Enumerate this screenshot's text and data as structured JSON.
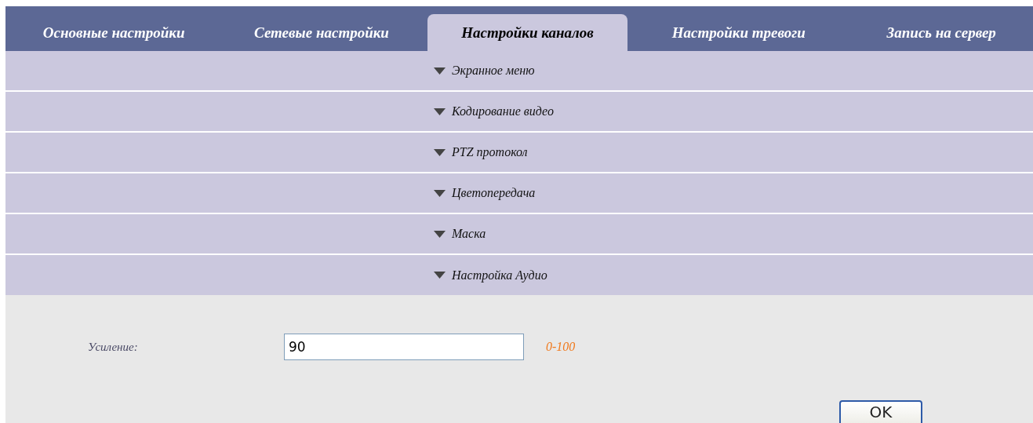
{
  "tabs": [
    {
      "label": "Основные настройки",
      "selected": false
    },
    {
      "label": "Сетевые настройки",
      "selected": false
    },
    {
      "label": "Настройки каналов",
      "selected": true
    },
    {
      "label": "Настройки тревоги",
      "selected": false
    },
    {
      "label": "Запись на сервер",
      "selected": false
    }
  ],
  "sections": [
    {
      "title": "Экранное меню"
    },
    {
      "title": "Кодирование видео"
    },
    {
      "title": "PTZ протокол"
    },
    {
      "title": "Цветопередача"
    },
    {
      "title": "Маска"
    },
    {
      "title": "Настройка Аудио"
    }
  ],
  "audio_panel": {
    "label": "Усиление:",
    "value": "90",
    "range": "0-100"
  },
  "buttons": [
    "OK"
  ]
}
